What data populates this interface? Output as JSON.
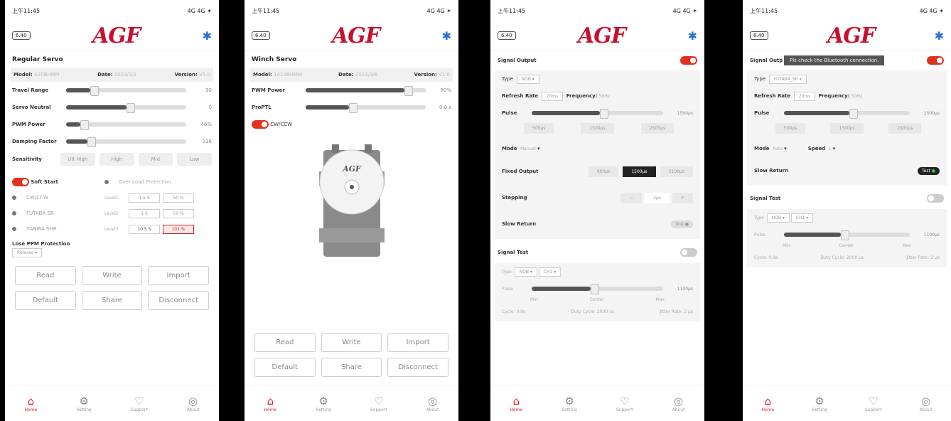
{
  "status": {
    "time": "上午11:45",
    "signal": "4G 4G ✶"
  },
  "battery": "6.40",
  "logo": "AGF",
  "nav": [
    {
      "label": "Home",
      "icon": "home-icon"
    },
    {
      "label": "Setting",
      "icon": "gear-icon"
    },
    {
      "label": "Support",
      "icon": "heart-icon"
    },
    {
      "label": "About",
      "icon": "globe-icon"
    }
  ],
  "buttons": [
    "Read",
    "Write",
    "Import",
    "Default",
    "Share",
    "Disconnect"
  ],
  "p1": {
    "title": "Regular Servo",
    "info": {
      "model_k": "Model:",
      "model_v": "A20BHMM",
      "date_k": "Date:",
      "date_v": "2023/2/2",
      "ver_k": "Version:",
      "ver_v": "V1.0"
    },
    "sliders": [
      {
        "label": "Travel Range",
        "val": "90",
        "fill": 0.2
      },
      {
        "label": "Servo Neutral",
        "val": "0",
        "fill": 0.5
      },
      {
        "label": "PWM Power",
        "val": "46%",
        "fill": 0.12
      },
      {
        "label": "Damping Factor",
        "val": "316",
        "fill": 0.18
      }
    ],
    "sens_label": "Sensitivity",
    "sens": [
      "Ult High",
      "High",
      "Mid",
      "Low"
    ],
    "softstart": "Soft Start",
    "olp": "Over Load Protection",
    "radios": [
      "CW/CCW",
      "FUTABA SR",
      "SANWA SHR"
    ],
    "levels": [
      {
        "l": "Level1",
        "a": "1.5 S",
        "b": "50 %"
      },
      {
        "l": "Level2",
        "a": "1 S",
        "b": "50 %"
      },
      {
        "l": "Level3",
        "a": "10.5 S",
        "b": "101 %"
      }
    ],
    "lpp": "Lose PPM Protection",
    "lpp_sel": "Release"
  },
  "p2": {
    "title": "Winch Servo",
    "info": {
      "model_k": "Model:",
      "model_v": "1410BHMM",
      "date_k": "Date:",
      "date_v": "2023/3/8",
      "ver_k": "Version:",
      "ver_v": "V1.0"
    },
    "sliders": [
      {
        "label": "PWM Power",
        "val": "80%",
        "fill": 0.82
      },
      {
        "label": "ProPTL",
        "val": "0.0 s",
        "fill": 0.36
      }
    ],
    "cw": "CW/CCW"
  },
  "p3": {
    "sig_out": "Signal Output",
    "type_k": "Type",
    "type_v": "NOB",
    "rr_k": "Refresh Rate",
    "rr_v": "20ms",
    "freq_k": "Frequency:",
    "freq_v": "50Hz",
    "pulse_k": "Pulse",
    "pulse_v": "1500μs",
    "pulse_opts": [
      "500μs",
      "1500μs",
      "2500μs"
    ],
    "mode_k": "Mode",
    "mode_v": "Manual",
    "fixed_k": "Fixed Output",
    "fixed": [
      "900μs",
      "1500μs",
      "2100μs"
    ],
    "step_k": "Stepping",
    "step_v": "2μs",
    "slow_k": "Slow Return",
    "test": "Test",
    "sig_test": "Signal Test",
    "t_type_k": "Type",
    "t_type_v": "NOB",
    "t_ch": "CH1",
    "t_pulse_k": "Pulse",
    "t_pulse_v": "1100μs",
    "t_min": "Min",
    "t_center": "Center",
    "t_max": "Max",
    "cycle_k": "Cycle:",
    "cycle_v": "0.8s",
    "duty_k": "Duty Cycle:",
    "duty_v": "2000 us",
    "jitter_k": "Jitter Rate:",
    "jitter_v": "2 μs"
  },
  "p4": {
    "sig_out": "Signal Outp",
    "tooltip": "Pls check the Bluetooth connection.",
    "type_k": "Type",
    "type_v": "FUTABA_SR",
    "rr_k": "Refresh Rate",
    "rr_v": "20ms",
    "freq_k": "Frequency:",
    "freq_v": "50Hz",
    "pulse_k": "Pulse",
    "pulse_v": "1500μs",
    "pulse_opts": [
      "500μs",
      "1500μs",
      "2500μs"
    ],
    "mode_k": "Mode",
    "mode_v": "Auto",
    "speed_k": "Speed",
    "speed_v": "1",
    "slow_k": "Slow Return",
    "test": "Test",
    "sig_test": "Signal Test",
    "t_type_k": "Type",
    "t_type_v": "NOB",
    "t_ch": "CH1",
    "t_pulse_k": "Pulse",
    "t_pulse_v": "1100μs",
    "t_min": "Min",
    "t_center": "Center",
    "t_max": "Max",
    "cycle_k": "Cycle:",
    "cycle_v": "0.8s",
    "duty_k": "Duty Cycle:",
    "duty_v": "2000 us",
    "jitter_k": "Jitter Rate:",
    "jitter_v": "2 μs"
  }
}
